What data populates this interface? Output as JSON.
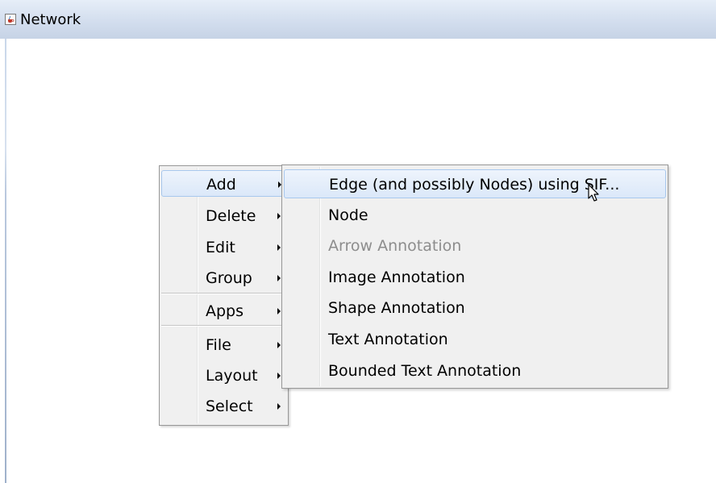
{
  "window": {
    "title": "Network",
    "icon": "java-cup-icon"
  },
  "context_menu": {
    "items": [
      {
        "label": "Add",
        "has_submenu": true,
        "highlighted": true
      },
      {
        "label": "Delete",
        "has_submenu": true
      },
      {
        "label": "Edit",
        "has_submenu": true
      },
      {
        "label": "Group",
        "has_submenu": true
      },
      {
        "label": "Apps",
        "has_submenu": true
      },
      {
        "label": "File",
        "has_submenu": true
      },
      {
        "label": "Layout",
        "has_submenu": true
      },
      {
        "label": "Select",
        "has_submenu": true
      }
    ]
  },
  "add_submenu": {
    "items": [
      {
        "label": "Edge (and possibly Nodes) using SIF...",
        "highlighted": true,
        "enabled": true
      },
      {
        "label": "Node",
        "enabled": true
      },
      {
        "label": "Arrow Annotation",
        "enabled": false
      },
      {
        "label": "Image Annotation",
        "enabled": true
      },
      {
        "label": "Shape Annotation",
        "enabled": true
      },
      {
        "label": "Text Annotation",
        "enabled": true
      },
      {
        "label": "Bounded Text Annotation",
        "enabled": true
      }
    ]
  },
  "colors": {
    "highlight_border": "#a8c8ee",
    "menu_background": "#f0f0f0",
    "disabled_text": "#8d8d8d"
  },
  "cursor": "arrow-cursor-icon"
}
